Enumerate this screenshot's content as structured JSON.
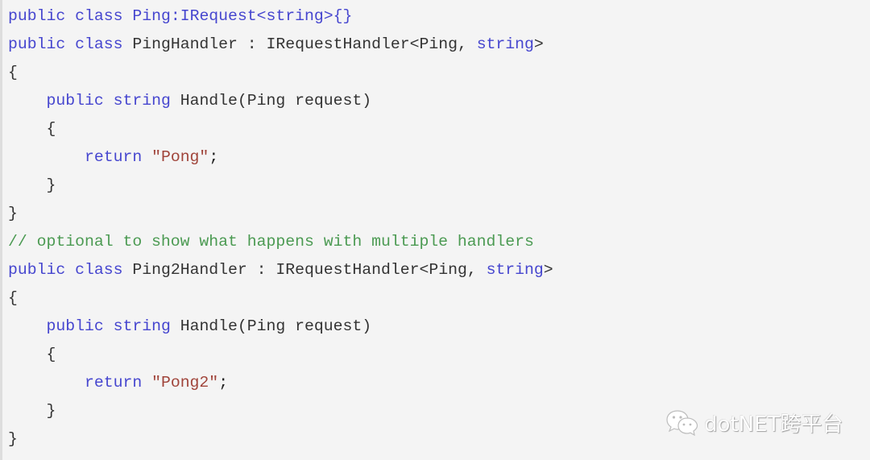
{
  "code": {
    "language": "csharp",
    "lines": [
      {
        "tokens": [
          {
            "t": "public",
            "c": "kw"
          },
          {
            "t": " ",
            "c": "plain"
          },
          {
            "t": "class",
            "c": "kw"
          },
          {
            "t": " ",
            "c": "plain"
          },
          {
            "t": "Ping:IRequest<string>{}",
            "c": "kw"
          }
        ]
      },
      {
        "tokens": [
          {
            "t": "public",
            "c": "kw"
          },
          {
            "t": " ",
            "c": "plain"
          },
          {
            "t": "class",
            "c": "kw"
          },
          {
            "t": " PingHandler : IRequestHandler<Ping, ",
            "c": "plain"
          },
          {
            "t": "string",
            "c": "kw"
          },
          {
            "t": ">",
            "c": "plain"
          }
        ]
      },
      {
        "tokens": [
          {
            "t": "{",
            "c": "plain"
          }
        ]
      },
      {
        "tokens": [
          {
            "t": "    ",
            "c": "plain"
          },
          {
            "t": "public",
            "c": "kw"
          },
          {
            "t": " ",
            "c": "plain"
          },
          {
            "t": "string",
            "c": "kw"
          },
          {
            "t": " Handle(Ping request)",
            "c": "plain"
          }
        ]
      },
      {
        "tokens": [
          {
            "t": "    {",
            "c": "plain"
          }
        ]
      },
      {
        "tokens": [
          {
            "t": "        ",
            "c": "plain"
          },
          {
            "t": "return",
            "c": "kw"
          },
          {
            "t": " ",
            "c": "plain"
          },
          {
            "t": "\"Pong\"",
            "c": "str"
          },
          {
            "t": ";",
            "c": "punc"
          }
        ]
      },
      {
        "tokens": [
          {
            "t": "    }",
            "c": "plain"
          }
        ]
      },
      {
        "tokens": [
          {
            "t": "}",
            "c": "plain"
          }
        ]
      },
      {
        "tokens": [
          {
            "t": "// optional to show what happens with multiple handlers",
            "c": "cm"
          }
        ]
      },
      {
        "tokens": [
          {
            "t": "public",
            "c": "kw"
          },
          {
            "t": " ",
            "c": "plain"
          },
          {
            "t": "class",
            "c": "kw"
          },
          {
            "t": " Ping2Handler : IRequestHandler<Ping, ",
            "c": "plain"
          },
          {
            "t": "string",
            "c": "kw"
          },
          {
            "t": ">",
            "c": "plain"
          }
        ]
      },
      {
        "tokens": [
          {
            "t": "{",
            "c": "plain"
          }
        ]
      },
      {
        "tokens": [
          {
            "t": "    ",
            "c": "plain"
          },
          {
            "t": "public",
            "c": "kw"
          },
          {
            "t": " ",
            "c": "plain"
          },
          {
            "t": "string",
            "c": "kw"
          },
          {
            "t": " Handle(Ping request)",
            "c": "plain"
          }
        ]
      },
      {
        "tokens": [
          {
            "t": "    {",
            "c": "plain"
          }
        ]
      },
      {
        "tokens": [
          {
            "t": "        ",
            "c": "plain"
          },
          {
            "t": "return",
            "c": "kw"
          },
          {
            "t": " ",
            "c": "plain"
          },
          {
            "t": "\"Pong2\"",
            "c": "str"
          },
          {
            "t": ";",
            "c": "punc"
          }
        ]
      },
      {
        "tokens": [
          {
            "t": "    }",
            "c": "plain"
          }
        ]
      },
      {
        "tokens": [
          {
            "t": "}",
            "c": "plain"
          }
        ]
      }
    ]
  },
  "colors": {
    "background": "#f4f4f4",
    "keyword": "#4646cf",
    "string": "#a0443a",
    "comment": "#4b9a52",
    "text": "#333333"
  },
  "watermark": {
    "icon": "wechat-icon",
    "text": "dotNET跨平台"
  }
}
